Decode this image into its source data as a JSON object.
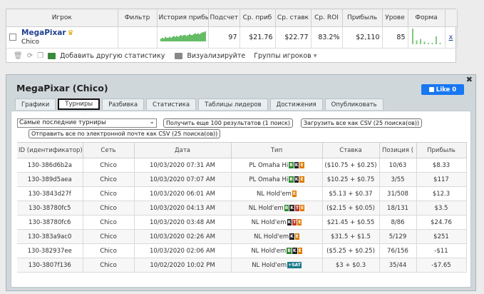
{
  "stats": {
    "headers": [
      "Игрок",
      "Фильтр",
      "История прибы",
      "Подсчет",
      "Ср. приб",
      "Ср. ставк",
      "Ср. ROI",
      "Прибыль",
      "Урове",
      "Форма",
      ""
    ],
    "player": {
      "name": "MegaPixar",
      "network": "Chico",
      "count": "97",
      "avg_profit": "$21.76",
      "avg_stake": "$22.77",
      "avg_roi": "83.2%",
      "profit": "$2,110",
      "level": "85",
      "remove": "x"
    },
    "history_spark": [
      3,
      4,
      3,
      5,
      4,
      4,
      5,
      4,
      5,
      6,
      5,
      6,
      5,
      6,
      7,
      6,
      7,
      7,
      6,
      7,
      8,
      7,
      7,
      8,
      9,
      8,
      9,
      8,
      9,
      10,
      10,
      11
    ],
    "form_spark": [
      12,
      3,
      4,
      2,
      1,
      1,
      6,
      1
    ],
    "toolbar": {
      "add_stat": "Добавить другую статистику",
      "visualize": "Визуализируйте",
      "player_groups": "Группы игроков"
    }
  },
  "panel": {
    "title": "MegaPixar (Chico)",
    "like": "Like 0",
    "tabs": [
      "Графики",
      "Турниры",
      "Разбивка",
      "Статистика",
      "Таблицы лидеров",
      "Достижения",
      "Опубликовать"
    ],
    "active_tab": 1,
    "filter_value": "Самые последние турниры",
    "btn_more": "Получить еще 100 результатов (1 поиск)",
    "btn_csv": "Загрузить все как CSV (25 поиска(ов))",
    "btn_email": "Отправить все по электронной почте как CSV (25 поиска(ов))"
  },
  "tourneys": {
    "columns": [
      "ID (идентификатор)",
      "Сеть",
      "Дата",
      "Тип",
      "Ставка",
      "Позиция (",
      "Прибыль"
    ],
    "rows": [
      {
        "id": "130-386d6b2a",
        "net": "Chico",
        "date": "10/03/2020 07:31 AM",
        "type": "PL Omaha Hi",
        "badges": [
          "b-g:B",
          "b-k:K",
          "b-o:E"
        ],
        "stake": "($10.75 + $0.25)",
        "pos": "10/63",
        "profit": "$8.33",
        "neg": false
      },
      {
        "id": "130-389d5aea",
        "net": "Chico",
        "date": "10/03/2020 07:07 AM",
        "type": "PL Omaha Hi",
        "badges": [
          "b-g:B",
          "b-k:K",
          "b-o:E"
        ],
        "stake": "$10.25 + $0.75",
        "pos": "3/55",
        "profit": "$117",
        "neg": false
      },
      {
        "id": "130-3843d27f",
        "net": "Chico",
        "date": "10/03/2020 06:01 AM",
        "type": "NL Hold'em",
        "badges": [
          "b-o:E"
        ],
        "stake": "$5.13 + $0.37",
        "pos": "31/508",
        "profit": "$12.3",
        "neg": false
      },
      {
        "id": "130-38780fc5",
        "net": "Chico",
        "date": "10/03/2020 04:13 AM",
        "type": "NL Hold'em",
        "badges": [
          "b-g:B",
          "b-k:K",
          "b-r:T",
          "b-o:E"
        ],
        "stake": "($2.15 + $0.05)",
        "pos": "18/131",
        "profit": "$3.5",
        "neg": false
      },
      {
        "id": "130-38780fc6",
        "net": "Chico",
        "date": "10/03/2020 03:48 AM",
        "type": "NL Hold'em",
        "badges": [
          "b-k:K",
          "b-r:T",
          "b-o:E"
        ],
        "stake": "$21.45 + $0.55",
        "pos": "8/86",
        "profit": "$24.76",
        "neg": false
      },
      {
        "id": "130-383a9ac0",
        "net": "Chico",
        "date": "10/03/2020 02:26 AM",
        "type": "NL Hold'em",
        "badges": [
          "b-k:K",
          "b-o:E"
        ],
        "stake": "$31.5 + $1.5",
        "pos": "5/129",
        "profit": "$251",
        "neg": false
      },
      {
        "id": "130-382937ee",
        "net": "Chico",
        "date": "10/03/2020 02:06 AM",
        "type": "NL Hold'em",
        "badges": [
          "b-g:B",
          "b-k:K",
          "b-o:E"
        ],
        "stake": "($5.25 + $0.25)",
        "pos": "76/156",
        "profit": "-$11",
        "neg": true
      },
      {
        "id": "130-3807f136",
        "net": "Chico",
        "date": "10/02/2020 10:02 PM",
        "type": "NL Hold'em",
        "badges": [
          "b-t:+SAT"
        ],
        "stake": "$3 + $0.3",
        "pos": "35/44",
        "profit": "-$7.65",
        "neg": true
      }
    ]
  }
}
